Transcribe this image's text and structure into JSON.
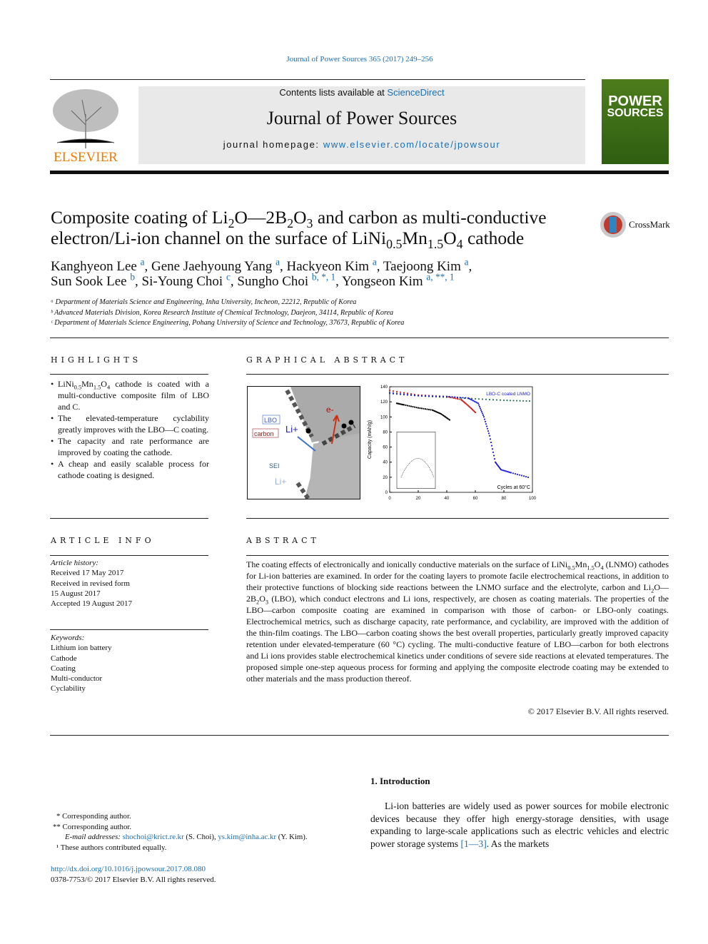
{
  "journal_ref": "Journal of Power Sources 365 (2017) 249–256",
  "masthead": {
    "contents_prefix": "Contents lists available at ",
    "sciencedirect": "ScienceDirect",
    "journal_title": "Journal of Power Sources",
    "homepage_prefix": "journal homepage: ",
    "homepage_url": "www.elsevier.com/locate/jpowsour",
    "publisher": "ELSEVIER",
    "cover_title_1": "POWER",
    "cover_title_2": "SOURCES"
  },
  "crossmark": "CrossMark",
  "title_html": "Composite coating of Li<sub>2</sub>O—2B<sub>2</sub>O<sub>3</sub> and carbon as multi-conductive electron/Li-ion channel on the surface of LiNi<sub>0.5</sub>Mn<sub>1.5</sub>O<sub>4</sub> cathode",
  "authors_html": "Kanghyeon Lee <sup class='link'>a</sup>, Gene Jaehyoung Yang <sup class='link'>a</sup>, Hackyeon Kim <sup class='link'>a</sup>, Taejoong Kim <sup class='link'>a</sup>,<br>Sun Sook Lee <sup class='link'>b</sup>, Si-Young Choi <sup class='link'>c</sup>, Sungho Choi <sup class='link'>b, *, 1</sup>, Yongseon Kim <sup class='link'>a, **, 1</sup>",
  "affiliations": [
    "ᵃ Department of Materials Science and Engineering, Inha University, Incheon, 22212, Republic of Korea",
    "ᵇ Advanced Materials Division, Korea Research Institute of Chemical Technology, Daejeon, 34114, Republic of Korea",
    "ᶜ Department of Materials Science Engineering, Pohang University of Science and Technology, 37673, Republic of Korea"
  ],
  "highlights": {
    "heading": "HIGHLIGHTS",
    "items_html": [
      "LiNi<sub>0.5</sub>Mn<sub>1.5</sub>O<sub>4</sub> cathode is coated with a multi-conductive composite film of LBO and C.",
      "The elevated-temperature cyclability greatly improves with the LBO—C coating.",
      "The capacity and rate performance are improved by coating the cathode.",
      "A cheap and easily scalable process for cathode coating is designed."
    ]
  },
  "graphical_abstract": {
    "heading": "GRAPHICAL ABSTRACT",
    "labels": {
      "lbo": "LBO",
      "carbon": "carbon",
      "li": "Li+",
      "sei": "SEI",
      "e": "e-",
      "legend": "LBO-C coated LNMO",
      "ylabel": "Capacity (mAh/g)",
      "note": "Cycles at 60°C"
    },
    "chart_data": {
      "type": "scatter",
      "ylabel": "Capacity (mAh/g)",
      "xlim": [
        0,
        100
      ],
      "ylim": [
        0,
        140
      ],
      "xticks": [
        "0",
        "20",
        "40",
        "60",
        "80",
        "100"
      ],
      "yticks": [
        "0",
        "20",
        "40",
        "60",
        "80",
        "100",
        "120",
        "140"
      ],
      "annotation": "Cycles at 60°C",
      "legend_entry": "LBO-C coated LNMO",
      "series": [
        {
          "color": "#2f6f5f",
          "x": [
            0,
            20,
            40,
            60,
            80,
            98
          ],
          "y": [
            131,
            128,
            126,
            124,
            122,
            121
          ]
        },
        {
          "color": "#d02020",
          "x": [
            0,
            20,
            40,
            50,
            55,
            60
          ],
          "y": [
            135,
            129,
            127,
            123,
            115,
            106
          ]
        },
        {
          "color": "#2020e0",
          "x": [
            0,
            20,
            40,
            55,
            62,
            66,
            70,
            74,
            78,
            85,
            97
          ],
          "y": [
            132,
            128,
            127,
            125,
            118,
            100,
            75,
            40,
            30,
            26,
            20
          ]
        },
        {
          "color": "#000000",
          "x": [
            5,
            10,
            20,
            30,
            36,
            42
          ],
          "y": [
            118,
            116,
            112,
            109,
            104,
            96
          ]
        }
      ]
    }
  },
  "article_info": {
    "heading": "ARTICLE INFO",
    "history_label": "Article history:",
    "history": [
      "Received 17 May 2017",
      "Received in revised form",
      "15 August 2017",
      "Accepted 19 August 2017"
    ],
    "keywords_label": "Keywords:",
    "keywords": [
      "Lithium ion battery",
      "Cathode",
      "Coating",
      "Multi-conductor",
      "Cyclability"
    ]
  },
  "abstract": {
    "heading": "ABSTRACT",
    "text_html": "The coating effects of electronically and ionically conductive materials on the surface of LiNi<sub>0.5</sub>Mn<sub>1.5</sub>O<sub>4</sub> (LNMO) cathodes for Li-ion batteries are examined. In order for the coating layers to promote facile electrochemical reactions, in addition to their protective functions of blocking side reactions between the LNMO surface and the electrolyte, carbon and Li<sub>2</sub>O—2B<sub>2</sub>O<sub>3</sub> (LBO), which conduct electrons and Li ions, respectively, are chosen as coating materials. The properties of the LBO—carbon composite coating are examined in comparison with those of carbon- or LBO-only coatings. Electrochemical metrics, such as discharge capacity, rate performance, and cyclability, are improved with the addition of the thin-film coatings. The LBO—carbon coating shows the best overall properties, particularly greatly improved capacity retention under elevated-temperature (60 °C) cycling. The multi-conductive feature of LBO—carbon for both electrons and Li ions provides stable electrochemical kinetics under conditions of severe side reactions at elevated temperatures. The proposed simple one-step aqueous process for forming and applying the composite electrode coating may be extended to other materials and the mass production thereof.",
    "copyright": "© 2017 Elsevier B.V. All rights reserved."
  },
  "introduction": {
    "heading": "1.  Introduction",
    "text_html": "Li-ion batteries are widely used as power sources for mobile electronic devices because they offer high energy-storage densities, with usage expanding to large-scale applications such as electric vehicles and electric power storage systems <span class='link'>[1—3]</span>. As the markets"
  },
  "footnotes": {
    "star1": "* Corresponding author.",
    "star2": "** Corresponding author.",
    "email_label": "E-mail addresses:",
    "email1": "shochoi@krict.re.kr",
    "email1_name": " (S. Choi), ",
    "email2": "ys.kim@inha.ac.kr",
    "email2_name": " (Y. Kim).",
    "note1": "¹ These authors contributed equally."
  },
  "doi": "http://dx.doi.org/10.1016/j.jpowsour.2017.08.080",
  "issn": "0378-7753/© 2017 Elsevier B.V. All rights reserved."
}
